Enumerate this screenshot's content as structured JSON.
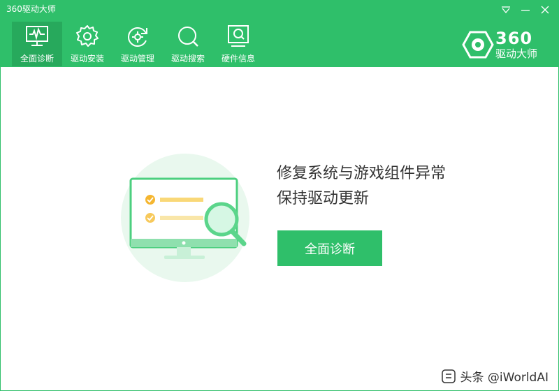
{
  "window": {
    "title": "360驱动大师"
  },
  "colors": {
    "accent": "#2fbf6a",
    "accent_dark": "#27a95c",
    "illustration_bg": "#e9f8ee",
    "check_yellow": "#f5b630"
  },
  "nav": {
    "items": [
      {
        "label": "全面诊断",
        "icon": "monitor-pulse-icon",
        "active": true
      },
      {
        "label": "驱动安装",
        "icon": "gear-icon",
        "active": false
      },
      {
        "label": "驱动管理",
        "icon": "refresh-gear-icon",
        "active": false
      },
      {
        "label": "驱动搜索",
        "icon": "search-icon",
        "active": false
      },
      {
        "label": "硬件信息",
        "icon": "hardware-info-icon",
        "active": false
      }
    ]
  },
  "brand": {
    "number": "360",
    "name": "驱动大师"
  },
  "main": {
    "headline_line1": "修复系统与游戏组件异常",
    "headline_line2": "保持驱动更新",
    "cta_label": "全面诊断"
  },
  "watermark": {
    "text": "头条 @iWorldAI"
  }
}
